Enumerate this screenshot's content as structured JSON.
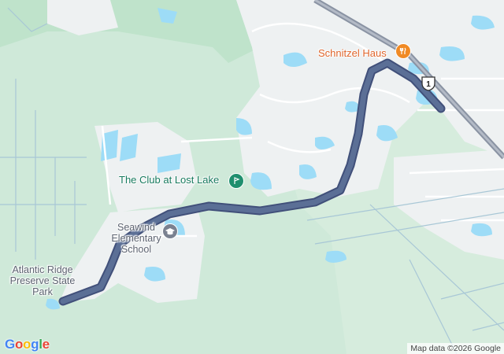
{
  "map": {
    "places": [
      {
        "id": "club",
        "label": "The Club at Lost Lake",
        "category": "golf-course"
      },
      {
        "id": "restaurant",
        "label": "Schnitzel Haus",
        "category": "restaurant"
      },
      {
        "id": "school",
        "label": "Seawind Elementary School",
        "category": "school"
      },
      {
        "id": "park",
        "label": "Atlantic Ridge Preserve State Park",
        "category": "park"
      }
    ],
    "route_shield": "1",
    "route_color": "#5b6f96",
    "attribution": "Map data ©2026 Google",
    "logo": "Google"
  }
}
